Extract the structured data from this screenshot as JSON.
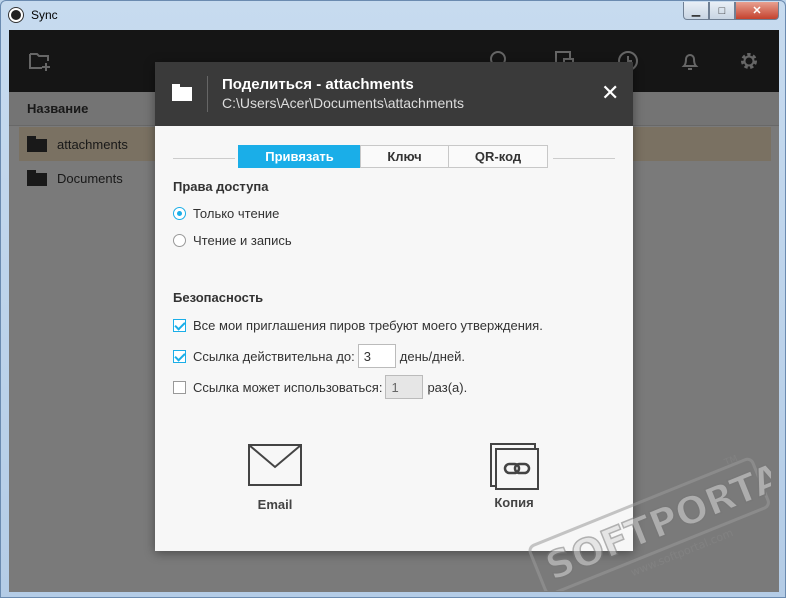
{
  "window": {
    "title": "Sync",
    "minimize": "▁",
    "maximize": "□",
    "close": "✕"
  },
  "toolbar": {
    "icons": [
      "add-folder-icon",
      "search-icon",
      "devices-icon",
      "history-icon",
      "bell-icon",
      "gear-icon"
    ]
  },
  "filelist": {
    "header": "Название",
    "items": [
      {
        "name": "attachments",
        "selected": true
      },
      {
        "name": "Documents",
        "selected": false
      }
    ]
  },
  "dialog": {
    "title": "Поделиться - attachments",
    "path": "C:\\Users\\Acer\\Documents\\attachments",
    "close": "✕",
    "tabs": [
      {
        "label": "Привязать",
        "active": true
      },
      {
        "label": "Ключ",
        "active": false
      },
      {
        "label": "QR-код",
        "active": false
      }
    ],
    "access": {
      "title": "Права доступа",
      "readonly": "Только чтение",
      "readwrite": "Чтение и запись",
      "selected": "readonly"
    },
    "security": {
      "title": "Безопасность",
      "approval": {
        "label": "Все мои приглашения пиров требуют моего утверждения.",
        "checked": true
      },
      "expires": {
        "label": "Ссылка действительна до:",
        "value": "3",
        "unit": "день/дней.",
        "checked": true
      },
      "uses": {
        "label": "Ссылка может использоваться:",
        "value": "1",
        "unit": "раз(а).",
        "checked": false
      }
    },
    "share": {
      "email": "Email",
      "copy": "Копия"
    }
  },
  "watermark": {
    "text": "SOFTPORTAL",
    "tm": "TM",
    "url": "www.softportal.com"
  },
  "colors": {
    "accent": "#1aaee8",
    "toolbar": "#2b2b2b",
    "dialog_header": "#3a3a3a",
    "selected_row": "#f5e3c4"
  }
}
